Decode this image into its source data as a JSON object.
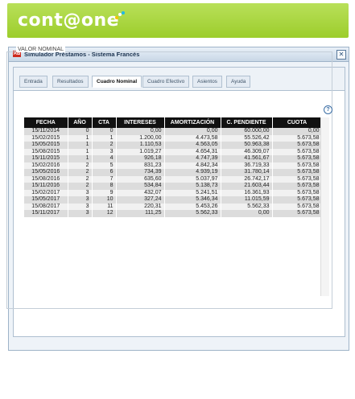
{
  "brand": {
    "logo_text": "cont@one"
  },
  "window": {
    "title": "Simulador Préstamos - Sistema Francés",
    "close_symbol": "✕",
    "app_icon_text": "AB"
  },
  "tabs": [
    {
      "label": "Entrada",
      "active": false
    },
    {
      "label": "Resultados",
      "active": false
    },
    {
      "label": "Cuadro Nominal",
      "active": true
    },
    {
      "label": "Cuadro Efectivo",
      "active": false
    },
    {
      "label": "Asientos",
      "active": false
    },
    {
      "label": "Ayuda",
      "active": false
    }
  ],
  "section": {
    "legend": "VALOR NOMINAL",
    "help_symbol": "?"
  },
  "table": {
    "headers": [
      "FECHA",
      "AÑO",
      "CTA",
      "INTERESES",
      "AMORTIZACIÓN",
      "C. PENDIENTE",
      "CUOTA"
    ],
    "rows": [
      [
        "15/11/2014",
        "0",
        "0",
        "0,00",
        "0,00",
        "60.000,00",
        "0,00"
      ],
      [
        "15/02/2015",
        "1",
        "1",
        "1.200,00",
        "4.473,58",
        "55.526,42",
        "5.673,58"
      ],
      [
        "15/05/2015",
        "1",
        "2",
        "1.110,53",
        "4.563,05",
        "50.963,38",
        "5.673,58"
      ],
      [
        "15/08/2015",
        "1",
        "3",
        "1.019,27",
        "4.654,31",
        "46.309,07",
        "5.673,58"
      ],
      [
        "15/11/2015",
        "1",
        "4",
        "926,18",
        "4.747,39",
        "41.561,67",
        "5.673,58"
      ],
      [
        "15/02/2016",
        "2",
        "5",
        "831,23",
        "4.842,34",
        "36.719,33",
        "5.673,58"
      ],
      [
        "15/05/2016",
        "2",
        "6",
        "734,39",
        "4.939,19",
        "31.780,14",
        "5.673,58"
      ],
      [
        "15/08/2016",
        "2",
        "7",
        "635,60",
        "5.037,97",
        "26.742,17",
        "5.673,58"
      ],
      [
        "15/11/2016",
        "2",
        "8",
        "534,84",
        "5.138,73",
        "21.603,44",
        "5.673,58"
      ],
      [
        "15/02/2017",
        "3",
        "9",
        "432,07",
        "5.241,51",
        "16.361,93",
        "5.673,58"
      ],
      [
        "15/05/2017",
        "3",
        "10",
        "327,24",
        "5.346,34",
        "11.015,59",
        "5.673,58"
      ],
      [
        "15/08/2017",
        "3",
        "11",
        "220,31",
        "5.453,26",
        "5.562,33",
        "5.673,58"
      ],
      [
        "15/11/2017",
        "3",
        "12",
        "111,25",
        "5.562,33",
        "0,00",
        "5.673,58"
      ]
    ]
  }
}
